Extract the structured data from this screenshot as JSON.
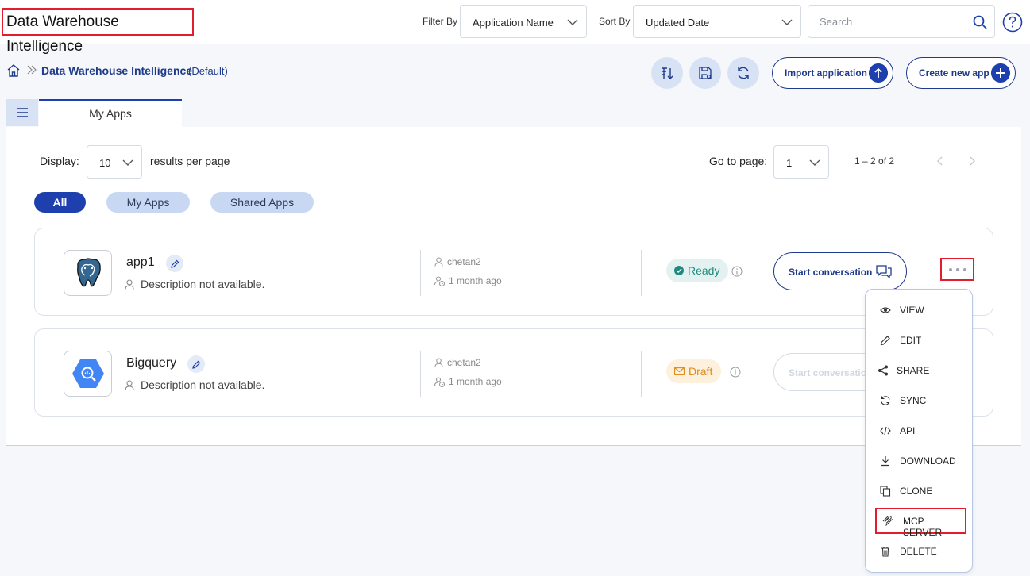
{
  "header": {
    "title": "Data Warehouse Intelligence",
    "filter_label": "Filter By",
    "filter_value": "Application Name",
    "sort_label": "Sort By",
    "sort_value": "Updated Date",
    "search_placeholder": "Search"
  },
  "breadcrumb": {
    "title": "Data Warehouse Intelligence",
    "suffix": "(Default)"
  },
  "actions": {
    "import_label": "Import application",
    "create_label": "Create new app"
  },
  "tabs": [
    {
      "label": "My Apps"
    }
  ],
  "pagination": {
    "display_label": "Display:",
    "per_page_value": "10",
    "per_page_suffix": "results per page",
    "goto_label": "Go to page:",
    "page_value": "1",
    "range_text": "1 – 2 of 2"
  },
  "filters": [
    {
      "label": "All",
      "active": true
    },
    {
      "label": "My Apps",
      "active": false
    },
    {
      "label": "Shared Apps",
      "active": false
    }
  ],
  "apps": [
    {
      "name": "app1",
      "description": "Description not available.",
      "owner": "chetan2",
      "updated": "1 month ago",
      "status": "Ready",
      "action_label": "Start conversation",
      "icon": "postgresql-elephant-icon"
    },
    {
      "name": "Bigquery",
      "description": "Description not available.",
      "owner": "chetan2",
      "updated": "1 month ago",
      "status": "Draft",
      "action_label": "Start conversation",
      "icon": "bigquery-icon"
    }
  ],
  "context_menu": {
    "items": [
      {
        "label": "VIEW",
        "icon": "eye-icon"
      },
      {
        "label": "EDIT",
        "icon": "pencil-icon"
      },
      {
        "label": "SHARE",
        "icon": "share-icon"
      },
      {
        "label": "SYNC",
        "icon": "sync-icon"
      },
      {
        "label": "API",
        "icon": "code-icon"
      },
      {
        "label": "DOWNLOAD",
        "icon": "download-icon"
      },
      {
        "label": "CLONE",
        "icon": "clone-icon"
      },
      {
        "label": "MCP SERVER",
        "icon": "mcp-server-icon"
      },
      {
        "label": "DELETE",
        "icon": "trash-icon"
      }
    ]
  },
  "colors": {
    "accent": "#1e40af",
    "highlight_border": "#e11d2e",
    "ready": "#1f8b80",
    "draft": "#e08a1a"
  }
}
